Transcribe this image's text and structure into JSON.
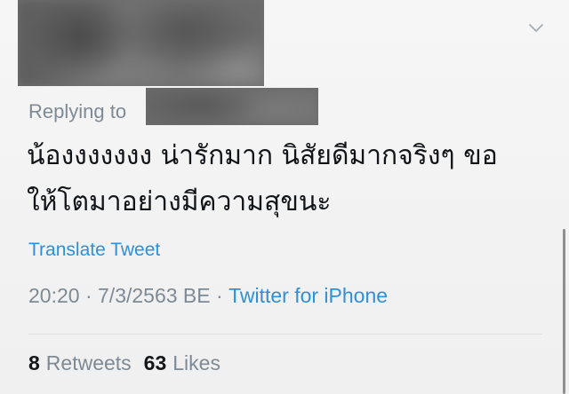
{
  "reply": {
    "prefix": "Replying to"
  },
  "tweet": {
    "lines": [
      "น้องงงงงงง น่ารักมาก นิสัยดีมากจริงๆ ขอ",
      "ให้โตมาอย่างมีความสุขนะ"
    ]
  },
  "translate_label": "Translate Tweet",
  "meta": {
    "time": "20:20",
    "separator1": " · ",
    "date": "7/3/2563 BE",
    "separator2": " · ",
    "source": "Twitter for iPhone"
  },
  "stats": {
    "retweets_count": "8",
    "retweets_label": "Retweets",
    "likes_count": "63",
    "likes_label": "Likes"
  },
  "icons": {
    "menu": "chevron-down-icon"
  },
  "colors": {
    "link": "#2f8fd8",
    "secondary_text": "#7d8a96",
    "primary_text": "#111418"
  }
}
